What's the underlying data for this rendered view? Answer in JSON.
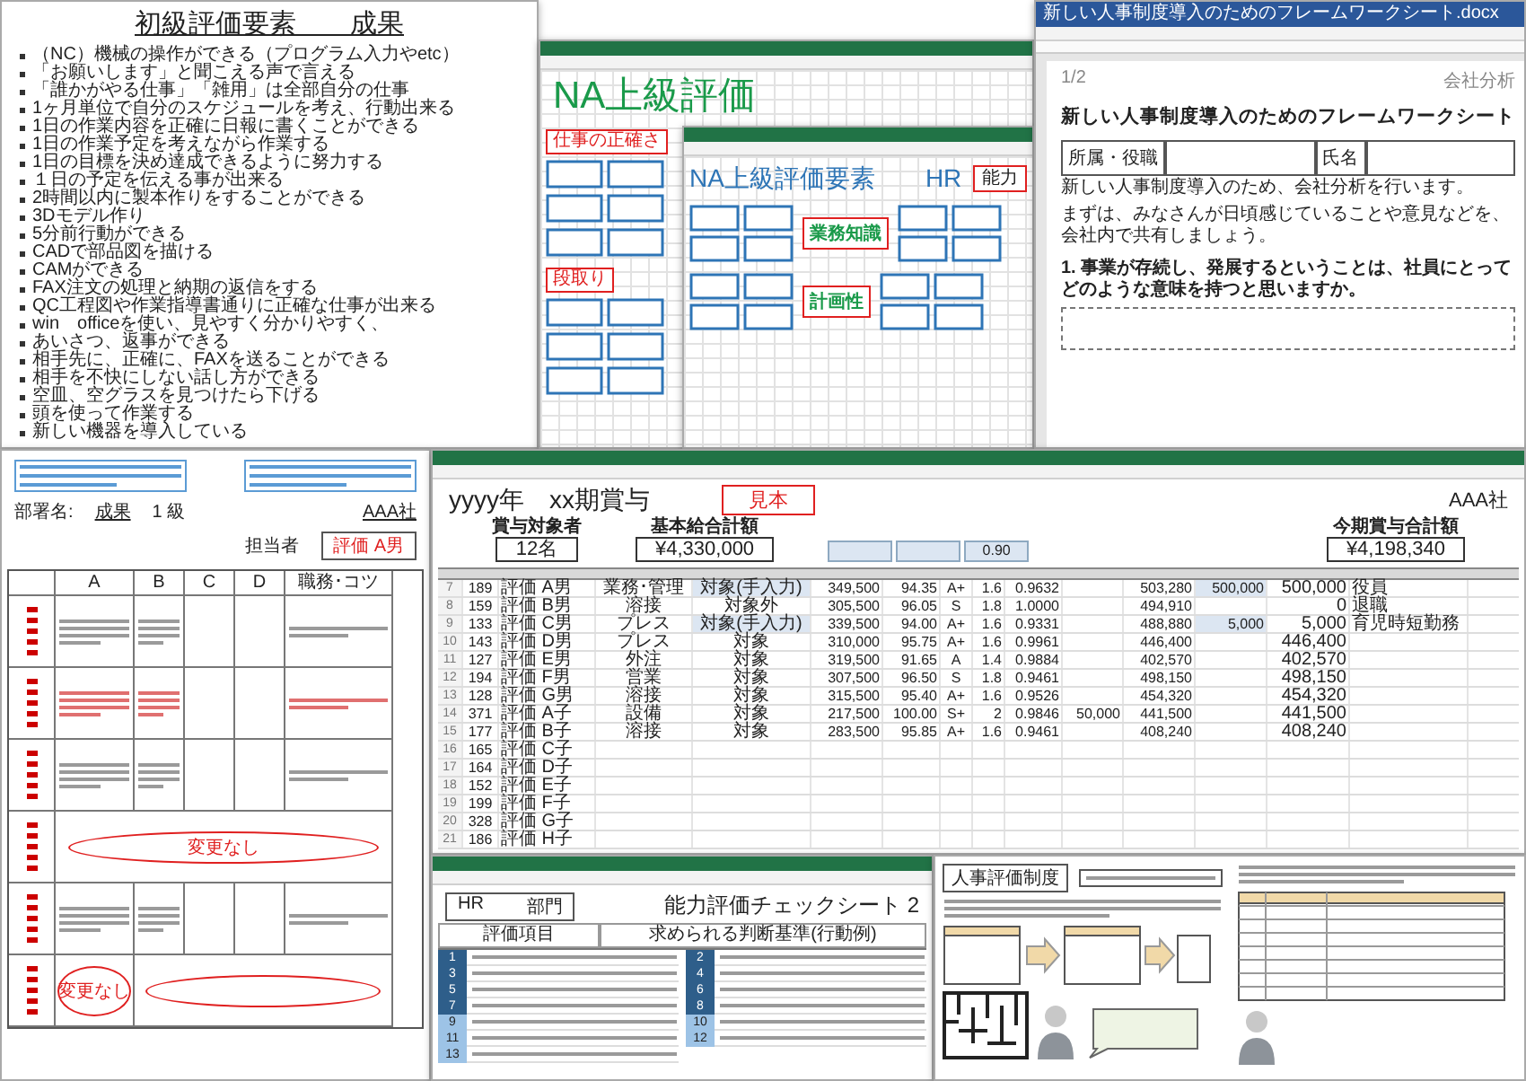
{
  "slide": {
    "title": "初級評価要素　　成果",
    "bullets": [
      "（NC）機械の操作ができる（プログラム入力やetc）",
      "「お願いします」と聞こえる声で言える",
      "「誰かがやる仕事」「雑用」は全部自分の仕事",
      "1ヶ月単位で自分のスケジュールを考え、行動出来る",
      "1日の作業内容を正確に日報に書くことができる",
      "1日の作業予定を考えながら作業する",
      "1日の目標を決め達成できるように努力する",
      "１日の予定を伝える事が出来る",
      "2時間以内に製本作りをすることができる",
      "3Dモデル作り",
      "5分前行動ができる",
      "CADで部品図を描ける",
      "CAMができる",
      "FAX注文の処理と納期の返信をする",
      "QC工程図や作業指導書通りに正確な仕事が出来る",
      "win　officeを使い、見やすく分かりやすく、",
      "あいさつ、返事ができる",
      "相手先に、正確に、FAXを送ることができる",
      "相手を不快にしない話し方ができる",
      "空皿、空グラスを見つけたら下げる",
      "頭を使って作業する",
      "新しい機器を導入している"
    ]
  },
  "na_sheet": {
    "title": "NA上級評価",
    "sections": [
      "仕事の正確さ",
      "段取り"
    ]
  },
  "hr_sheet": {
    "title": "NA上級評価要素　　HR",
    "labels": [
      {
        "text": "能力",
        "kind": "group"
      },
      {
        "text": "業務知識",
        "kind": "category"
      },
      {
        "text": "計画性",
        "kind": "category"
      }
    ]
  },
  "word_doc": {
    "file_name": "新しい人事制度導入のためのフレームワークシート.docx",
    "page": "1/2",
    "header_right": "会社分析",
    "heading": "新しい人事制度導入のためのフレームワークシート",
    "fields": [
      "所属・役職",
      "氏名"
    ],
    "intro": [
      "新しい人事制度導入のため、会社分析を行います。",
      "まずは、みなさんが日頃感じていることや意見などを、会社内で共有しましょう。"
    ],
    "question": "1. 事業が存続し、発展するということは、社員にとってどのような意味を持つと思いますか。"
  },
  "rating_sheet": {
    "department_label": "部署名:",
    "title": "成果",
    "grade": "1 級",
    "company": "AAA社",
    "rater_label": "担当者",
    "rater": "評価 A男",
    "columns": [
      "A",
      "B",
      "C",
      "D",
      "職務･コツ"
    ],
    "notes": [
      "変更なし",
      "変更なし"
    ]
  },
  "bonus_sheet": {
    "title": "yyyy年　xx期賞与",
    "stamp": "見本",
    "company": "AAA社",
    "summary": [
      {
        "label": "賞与対象者",
        "value": "12名"
      },
      {
        "label": "基本給合計額",
        "value": "¥4,330,000"
      },
      {
        "label": "今期賞与合計額",
        "value": "¥4,198,340"
      }
    ],
    "coefficient": "0.90",
    "rows": [
      {
        "line": "7",
        "manual": true,
        "cells": [
          "189",
          "評価 A男",
          "業務･管理",
          "対象(手入力)",
          "349,500",
          "94.35",
          "A+",
          "1.6",
          "0.9632",
          null,
          "503,280",
          "500,000",
          "500,000",
          "役員"
        ]
      },
      {
        "line": "8",
        "manual": false,
        "cells": [
          "159",
          "評価 B男",
          "溶接",
          "対象外",
          "305,500",
          "96.05",
          "S",
          "1.8",
          "1.0000",
          null,
          "494,910",
          null,
          "0",
          "退職"
        ]
      },
      {
        "line": "9",
        "manual": true,
        "cells": [
          "133",
          "評価 C男",
          "プレス",
          "対象(手入力)",
          "339,500",
          "94.00",
          "A+",
          "1.6",
          "0.9331",
          null,
          "488,880",
          "5,000",
          "5,000",
          "育児時短勤務"
        ]
      },
      {
        "line": "10",
        "manual": false,
        "cells": [
          "143",
          "評価 D男",
          "プレス",
          "対象",
          "310,000",
          "95.75",
          "A+",
          "1.6",
          "0.9961",
          null,
          "446,400",
          null,
          "446,400",
          null
        ]
      },
      {
        "line": "11",
        "manual": false,
        "cells": [
          "127",
          "評価 E男",
          "外注",
          "対象",
          "319,500",
          "91.65",
          "A",
          "1.4",
          "0.9884",
          null,
          "402,570",
          null,
          "402,570",
          null
        ]
      },
      {
        "line": "12",
        "manual": false,
        "cells": [
          "194",
          "評価 F男",
          "営業",
          "対象",
          "307,500",
          "96.50",
          "S",
          "1.8",
          "0.9461",
          null,
          "498,150",
          null,
          "498,150",
          null
        ]
      },
      {
        "line": "13",
        "manual": false,
        "cells": [
          "128",
          "評価 G男",
          "溶接",
          "対象",
          "315,500",
          "95.40",
          "A+",
          "1.6",
          "0.9526",
          null,
          "454,320",
          null,
          "454,320",
          null
        ]
      },
      {
        "line": "14",
        "manual": false,
        "cells": [
          "371",
          "評価 A子",
          "設備",
          "対象",
          "217,500",
          "100.00",
          "S+",
          "2",
          "0.9846",
          "50,000",
          "441,500",
          null,
          "441,500",
          null
        ]
      },
      {
        "line": "15",
        "manual": false,
        "cells": [
          "177",
          "評価 B子",
          "溶接",
          "対象",
          "283,500",
          "95.85",
          "A+",
          "1.6",
          "0.9461",
          null,
          "408,240",
          null,
          "408,240",
          null
        ]
      },
      {
        "line": "16",
        "manual": false,
        "cells": [
          "165",
          "評価 C子"
        ]
      },
      {
        "line": "17",
        "manual": false,
        "cells": [
          "164",
          "評価 D子"
        ]
      },
      {
        "line": "18",
        "manual": false,
        "cells": [
          "152",
          "評価 E子"
        ]
      },
      {
        "line": "19",
        "manual": false,
        "cells": [
          "199",
          "評価 F子"
        ]
      },
      {
        "line": "20",
        "manual": false,
        "cells": [
          "328",
          "評価 G子"
        ]
      },
      {
        "line": "21",
        "manual": false,
        "cells": [
          "186",
          "評価 H子"
        ]
      }
    ]
  },
  "check_sheet": {
    "title": "能力評価チェックシート 2",
    "department": "HR",
    "department_label": "部門",
    "columns": [
      "評価項目",
      "求められる判断基準(行動例)"
    ],
    "items": [
      "1",
      "2",
      "3",
      "4",
      "5",
      "6",
      "7",
      "8",
      "9",
      "10",
      "11",
      "12",
      "13"
    ]
  },
  "guide_doc": {
    "label": "人事評価制度"
  }
}
